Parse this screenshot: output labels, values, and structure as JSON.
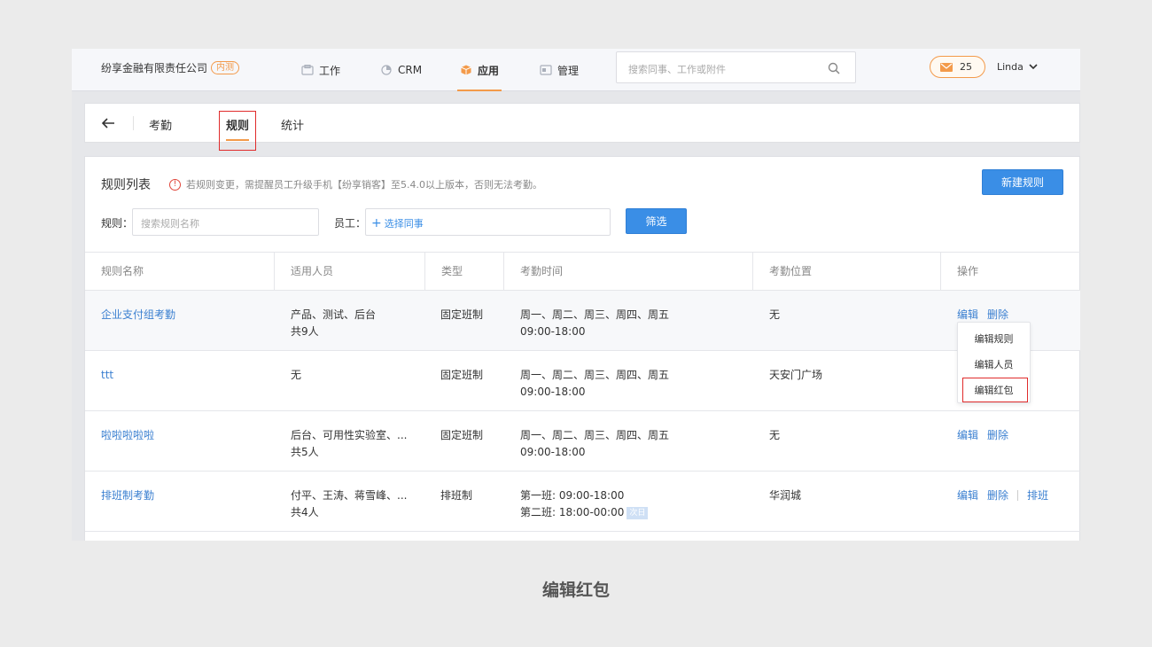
{
  "topnav": {
    "company": "纷享金融有限责任公司",
    "badge": "内测",
    "items": [
      {
        "label": "工作"
      },
      {
        "label": "CRM"
      },
      {
        "label": "应用",
        "active": true
      },
      {
        "label": "管理"
      }
    ],
    "search_placeholder": "搜索同事、工作或附件",
    "mail_count": "25",
    "user_name": "Linda"
  },
  "subnav": {
    "tabs": [
      {
        "label": "考勤"
      },
      {
        "label": "规则",
        "active": true
      },
      {
        "label": "统计"
      }
    ]
  },
  "main": {
    "title": "规则列表",
    "notice": "若规则变更，需提醒员工升级手机【纷享销客】至5.4.0以上版本，否则无法考勤。",
    "new_button": "新建规则",
    "filter": {
      "rule_label": "规则：",
      "rule_placeholder": "搜索规则名称",
      "staff_label": "员工：",
      "staff_add": "选择同事",
      "filter_button": "筛选"
    },
    "columns": [
      "规则名称",
      "适用人员",
      "类型",
      "考勤时间",
      "考勤位置",
      "操作"
    ],
    "rows": [
      {
        "name": "企业支付组考勤",
        "people": "产品、测试、后台",
        "people_count": "共9人",
        "type": "固定班制",
        "time1": "周一、周二、周三、周四、周五",
        "time2": "09:00-18:00",
        "location": "无",
        "ops": [
          "编辑",
          "删除"
        ]
      },
      {
        "name": "ttt",
        "people": "无",
        "people_count": "",
        "type": "固定班制",
        "time1": "周一、周二、周三、周四、周五",
        "time2": "09:00-18:00",
        "location": "天安门广场",
        "ops": []
      },
      {
        "name": "啦啦啦啦啦",
        "people": "后台、可用性实验室、...",
        "people_count": "共5人",
        "type": "固定班制",
        "time1": "周一、周二、周三、周四、周五",
        "time2": "09:00-18:00",
        "location": "无",
        "ops": [
          "编辑",
          "删除"
        ]
      },
      {
        "name": "排班制考勤",
        "people": "付平、王涛、蒋雪峰、...",
        "people_count": "共4人",
        "type": "排班制",
        "time1": "第一班: 09:00-18:00",
        "time2": "第二班: 18:00-00:00",
        "time_tag": "次日",
        "location": "华润城",
        "ops": [
          "编辑",
          "删除",
          "排班"
        ]
      }
    ],
    "dropdown": [
      "编辑规则",
      "编辑人员",
      "编辑红包"
    ]
  },
  "caption": "编辑红包",
  "colors": {
    "accent": "#f39a4a",
    "primary": "#3a8ee6",
    "link": "#3a7fd0",
    "highlight": "#e02b2b"
  }
}
